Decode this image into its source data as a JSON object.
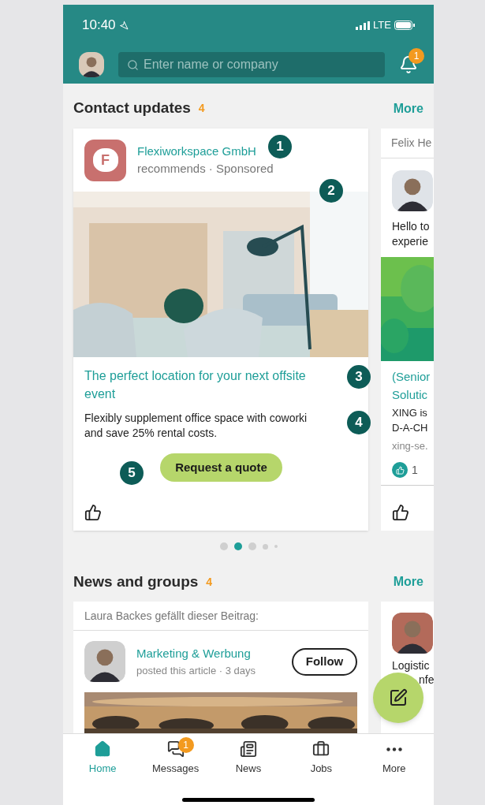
{
  "status_bar": {
    "time": "10:40",
    "network": "LTE"
  },
  "header": {
    "search": {
      "placeholder": "Enter name or company"
    },
    "notifications_badge": "1"
  },
  "contact_updates": {
    "title": "Contact updates",
    "count": "4",
    "more": "More",
    "ad_card": {
      "company": "Flexiworkspace GmbH",
      "logo_letter": "F",
      "subtitle": "recommends · Sponsored",
      "title_lines": [
        "The perfect location for your next offsite",
        "event"
      ],
      "text_lines": [
        "Flexibly supplement office space with coworki",
        "and save 25% rental costs."
      ],
      "button": "Request a quote"
    },
    "post_card": {
      "author": "Felix He",
      "text_lines": [
        "Hello to",
        "experie"
      ],
      "link_lines": [
        "(Senior",
        "Solutic"
      ],
      "body_lines": [
        "XING is",
        "D-A-CH"
      ],
      "source": "xing-se.",
      "likes": "1"
    },
    "pager": [
      {
        "selected": false
      },
      {
        "selected": true
      },
      {
        "selected": false
      },
      {
        "selected": false
      },
      {
        "selected": false
      }
    ]
  },
  "news_and_groups": {
    "title": "News and groups",
    "count": "4",
    "more": "More",
    "article_card": {
      "liked_by": "Laura Backes gefällt dieser Beitrag:",
      "group": "Marketing & Werbung",
      "meta": "posted this article · 3 days",
      "follow": "Follow"
    },
    "person_card": {
      "text_lines": [
        "Logistic",
        "nfe"
      ]
    }
  },
  "markers": [
    "1",
    "2",
    "3",
    "4",
    "5"
  ],
  "nav": [
    {
      "label": "Home",
      "selected": true
    },
    {
      "label": "Messages",
      "selected": false,
      "badge": "1"
    },
    {
      "label": "News",
      "selected": false
    },
    {
      "label": "Jobs",
      "selected": false
    },
    {
      "label": "More",
      "selected": false
    }
  ]
}
